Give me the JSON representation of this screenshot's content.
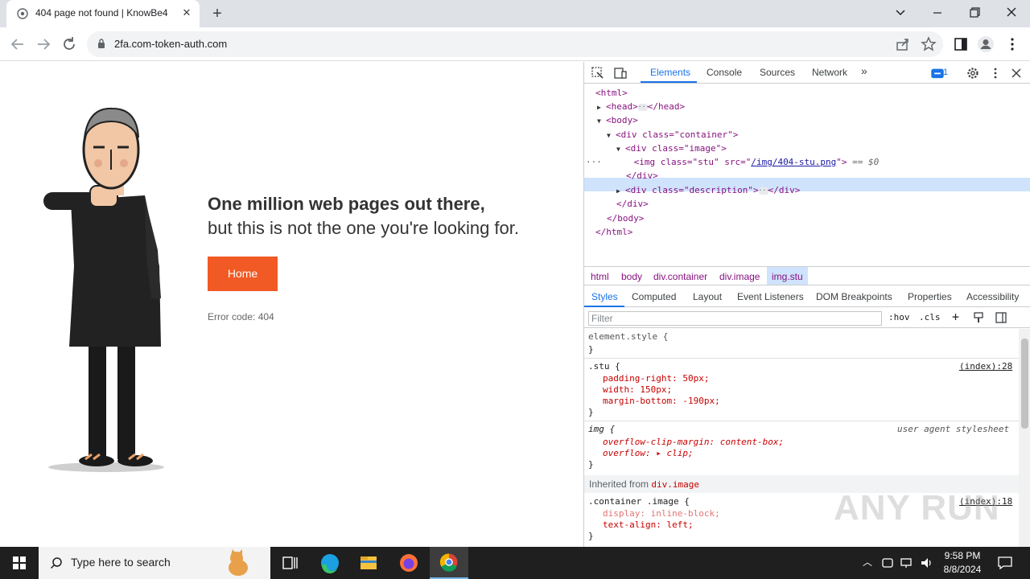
{
  "browser": {
    "tab_title": "404 page not found | KnowBe4",
    "url": "2fa.com-token-auth.com"
  },
  "page": {
    "headline_bold": "One million web pages out there,",
    "headline_regular": "but this is not the one you're looking for.",
    "home_button": "Home",
    "error_code": "Error code: 404"
  },
  "devtools": {
    "tabs": [
      "Elements",
      "Console",
      "Sources",
      "Network"
    ],
    "issues_count": "1",
    "dom": {
      "html_open": "<html>",
      "head": "<head>",
      "head_close": "</head>",
      "body_open": "<body>",
      "div_container": "<div class=\"container\">",
      "div_image": "<div class=\"image\">",
      "img_prefix": "<img class=\"stu\" src=\"",
      "img_src": "/img/404-stu.png",
      "img_suffix": "\">",
      "img_marker": "== $0",
      "div_close": "</div>",
      "div_description": "<div class=\"description\">",
      "div_desc_close": "</div>",
      "div_close2": "</div>",
      "body_close": "</body>",
      "html_close": "</html>"
    },
    "breadcrumbs": [
      "html",
      "body",
      "div.container",
      "div.image",
      "img.stu"
    ],
    "subtabs": [
      "Styles",
      "Computed",
      "Layout",
      "Event Listeners",
      "DOM Breakpoints",
      "Properties",
      "Accessibility"
    ],
    "filter_placeholder": "Filter",
    "hov": ":hov",
    "cls": ".cls",
    "styles": {
      "element_style": "element.style {",
      "close": "}",
      "stu_selector": ".stu {",
      "stu_source": "(index):28",
      "stu_props": [
        "padding-right: 50px;",
        "width: 150px;",
        "margin-bottom: -190px;"
      ],
      "img_selector": "img {",
      "img_source": "user agent stylesheet",
      "img_props": [
        "overflow-clip-margin: content-box;",
        "overflow: ▸ clip;"
      ],
      "inherited_label": "Inherited from",
      "inherited_from": "div.image",
      "container_selector": ".container .image {",
      "container_source": "(index):18",
      "container_props": [
        "display: inline-block;",
        "text-align: left;"
      ]
    },
    "watermark": "ANY RUN"
  },
  "taskbar": {
    "search_placeholder": "Type here to search",
    "time": "9:58 PM",
    "date": "8/8/2024"
  },
  "colors": {
    "accent": "#f15a24",
    "devtools_blue": "#1a73e8"
  }
}
